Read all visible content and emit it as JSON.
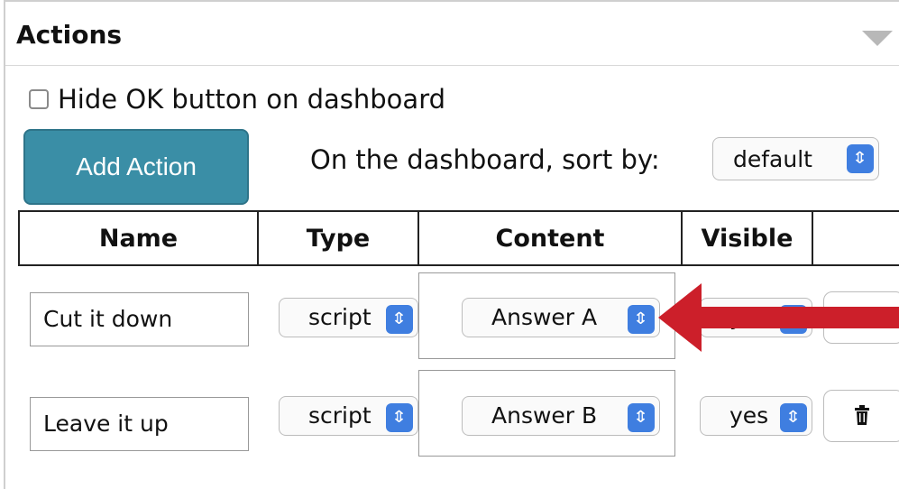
{
  "panel": {
    "title": "Actions",
    "hide_ok_label": "Hide OK button on dashboard",
    "hide_ok_checked": false,
    "add_action_label": "Add Action",
    "sort_label": "On the dashboard, sort by:",
    "sort_value": "default"
  },
  "table": {
    "headers": {
      "name": "Name",
      "type": "Type",
      "content": "Content",
      "visible": "Visible"
    },
    "rows": [
      {
        "name": "Cut it down",
        "type": "script",
        "content": "Answer A",
        "visible": "yes"
      },
      {
        "name": "Leave it up",
        "type": "script",
        "content": "Answer B",
        "visible": "yes"
      }
    ]
  },
  "icons": {
    "collapse": "triangle-down-icon",
    "select_spinner": "up-down-chevron-icon",
    "delete": "trash-icon",
    "annotation": "arrow-left-icon"
  },
  "colors": {
    "add_button": "#3a8ea6",
    "spinner": "#3f7ee0",
    "annotation_arrow": "#cc1f2a"
  }
}
